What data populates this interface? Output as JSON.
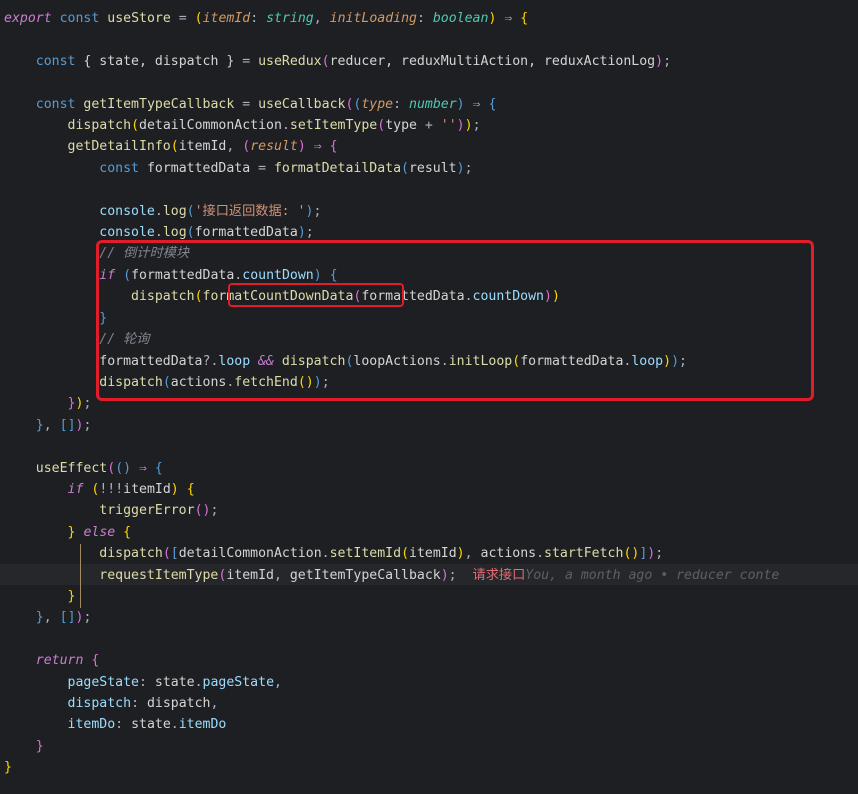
{
  "code": {
    "l1_export": "export",
    "l1_const": "const",
    "l1_useStore": "useStore",
    "l1_eq": " = ",
    "l1_p1": "itemId",
    "l1_c": ": ",
    "l1_t1": "string",
    "l1_cm": ", ",
    "l1_p2": "initLoading",
    "l1_t2": "boolean",
    "l1_arrow": " ⇒ ",
    "l3_const": "const",
    "l3_destr": "{ state, dispatch }",
    "l3_eq": " = ",
    "l3_fn": "useRedux",
    "l3_args": "reducer, reduxMultiAction, reduxActionLog",
    "l5_const": "const",
    "l5_name": "getItemTypeCallback",
    "l5_eq": " = ",
    "l5_fn": "useCallback",
    "l5_p": "type",
    "l5_t": "number",
    "l5_arrow": " ⇒ ",
    "l6_d": "dispatch",
    "l6_a": "detailCommonAction",
    "l6_m": "setItemType",
    "l6_arg": "type",
    "l6_plus": " + ",
    "l6_str": "''",
    "l7_fn": "getDetailInfo",
    "l7_a1": "itemId",
    "l7_p": "result",
    "l7_arrow": " ⇒ ",
    "l8_const": "const",
    "l8_n": "formattedData",
    "l8_eq": " = ",
    "l8_fn": "formatDetailData",
    "l8_a": "result",
    "l10_c": "console",
    "l10_m": "log",
    "l10_s": "'接口返回数据: '",
    "l11_c": "console",
    "l11_m": "log",
    "l11_a": "formattedData",
    "l12_cmt": "// 倒计时模块",
    "l13_if": "if",
    "l13_a": "formattedData",
    "l13_p": "countDown",
    "l14_d": "dispatch",
    "l14_fn": "formatCountDownData",
    "l14_a": "formattedData",
    "l14_p": "countDown",
    "l16_cmt": "// 轮询",
    "l17_a": "formattedData",
    "l17_p": "loop",
    "l17_and": " && ",
    "l17_d": "dispatch",
    "l17_o": "loopActions",
    "l17_m": "initLoop",
    "l17_a2": "formattedData",
    "l17_p2": "loop",
    "l18_d": "dispatch",
    "l18_o": "actions",
    "l18_m": "fetchEnd",
    "l21_fn": "useEffect",
    "l21_arrow": " ⇒ ",
    "l22_if": "if",
    "l22_neg": "!!!",
    "l22_a": "itemId",
    "l23_fn": "triggerError",
    "l24_else": "else",
    "l25_d": "dispatch",
    "l25_o": "detailCommonAction",
    "l25_m": "setItemId",
    "l25_a": "itemId",
    "l25_o2": "actions",
    "l25_m2": "startFetch",
    "l26_fn": "requestItemType",
    "l26_a1": "itemId",
    "l26_a2": "getItemTypeCallback",
    "l26_anno": "请求接口",
    "l26_blame": "You, a month ago • reducer conte",
    "l29_ret": "return",
    "l30_k": "pageState",
    "l30_v": "state",
    "l30_p": "pageState",
    "l31_k": "dispatch",
    "l31_v": "dispatch",
    "l32_k": "itemDo",
    "l32_v": "state",
    "l32_p": "itemDo"
  }
}
